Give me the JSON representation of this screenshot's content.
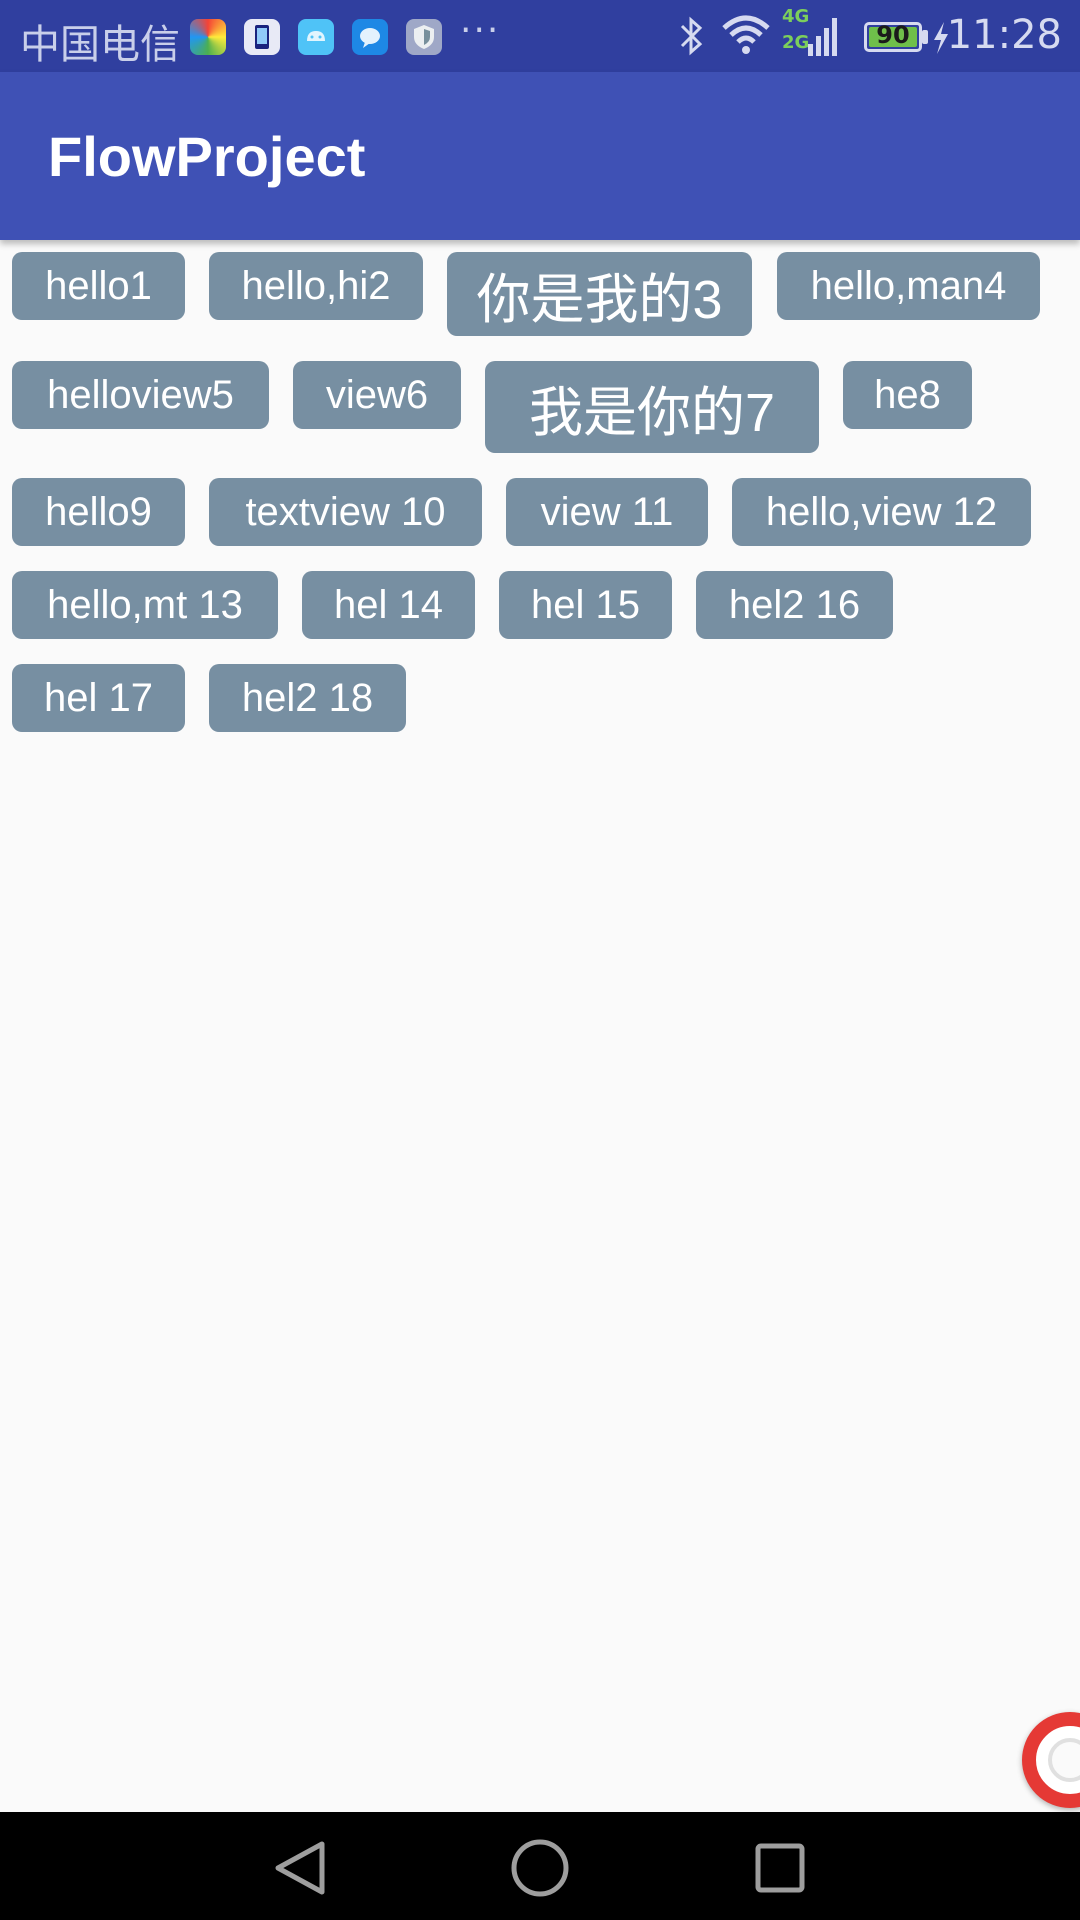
{
  "status_bar": {
    "carrier": "中国电信",
    "more": "···",
    "network_4g": "4G",
    "network_2g": "2G",
    "battery_level": "90",
    "time": "11:28",
    "icons": [
      "colorful-app-icon",
      "phone-manager-icon",
      "android-icon",
      "message-icon",
      "shield-icon"
    ],
    "right_icons": [
      "bluetooth-icon",
      "wifi-icon",
      "signal-icon",
      "battery-icon",
      "charging-icon"
    ]
  },
  "app_bar": {
    "title": "FlowProject"
  },
  "tags": [
    "hello1",
    "hello,hi2",
    "你是我的3",
    "hello,man4",
    "helloview5",
    "view6",
    "我是你的7",
    "he8",
    "hello9",
    "textview 10",
    "view 11",
    "hello,view 12",
    "hello,mt 13",
    "hel 14",
    "hel 15",
    "hel2 16",
    "hel 17",
    "hel2 18"
  ],
  "colors": {
    "status_bar": "#303f9f",
    "app_bar": "#3f51b5",
    "tag_background": "#778fa2",
    "page_background": "#fafafa"
  },
  "floating_button": "lifebuoy-icon",
  "nav_bar": {
    "buttons": [
      "back-icon",
      "home-icon",
      "recents-icon"
    ]
  }
}
